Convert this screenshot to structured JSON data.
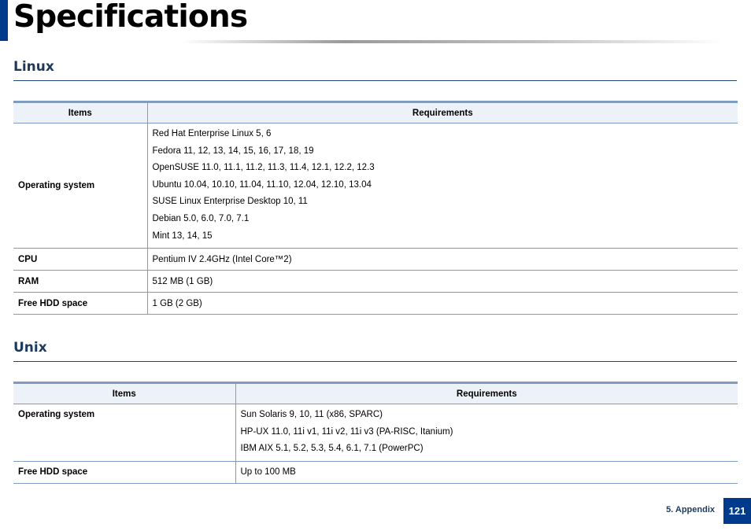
{
  "page": {
    "title": "Specifications"
  },
  "linux": {
    "heading": "Linux",
    "columns": [
      "Items",
      "Requirements"
    ],
    "os_label": "Operating system",
    "os_values": [
      "Red Hat Enterprise Linux 5, 6",
      "Fedora 11, 12, 13, 14, 15, 16, 17, 18, 19",
      "OpenSUSE 11.0, 11.1, 11.2, 11.3, 11.4, 12.1, 12.2, 12.3",
      "Ubuntu 10.04, 10.10, 11.04, 11.10, 12.04, 12.10, 13.04",
      "SUSE Linux Enterprise Desktop 10, 11",
      "Debian 5.0, 6.0, 7.0, 7.1",
      "Mint 13, 14, 15"
    ],
    "rows": [
      {
        "item": "CPU",
        "value": "Pentium IV 2.4GHz (Intel Core™2)"
      },
      {
        "item": "RAM",
        "value": "512 MB (1 GB)"
      },
      {
        "item": "Free HDD space",
        "value": "1 GB (2 GB)"
      }
    ]
  },
  "unix": {
    "heading": "Unix",
    "columns": [
      "Items",
      "Requirements"
    ],
    "os_label": "Operating system",
    "os_values": [
      "Sun Solaris 9, 10, 11 (x86, SPARC)",
      "HP-UX 11.0, 11i v1, 11i v2, 11i v3 (PA-RISC, Itanium)",
      "IBM AIX 5.1, 5.2, 5.3, 5.4, 6.1, 7.1 (PowerPC)"
    ],
    "rows": [
      {
        "item": "Free HDD space",
        "value": "Up to 100 MB"
      }
    ]
  },
  "footer": {
    "section": "5.  Appendix",
    "page_number": "121"
  },
  "colors": {
    "accent_blue": "#003a8c",
    "heading_text": "#1d3a5c",
    "table_border": "#7f9bbd",
    "header_fill": "#edf2f8"
  }
}
